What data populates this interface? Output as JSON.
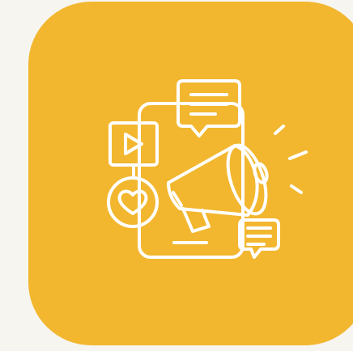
{
  "colors": {
    "background": "#f7f5f0",
    "tile": "#f2b72f",
    "icon_stroke": "#ffffff"
  },
  "icon": {
    "name": "social-media-marketing-icon",
    "parts": [
      "smartphone-icon",
      "chat-bubble-icon",
      "video-play-icon",
      "heart-icon",
      "megaphone-icon",
      "message-icon"
    ]
  }
}
